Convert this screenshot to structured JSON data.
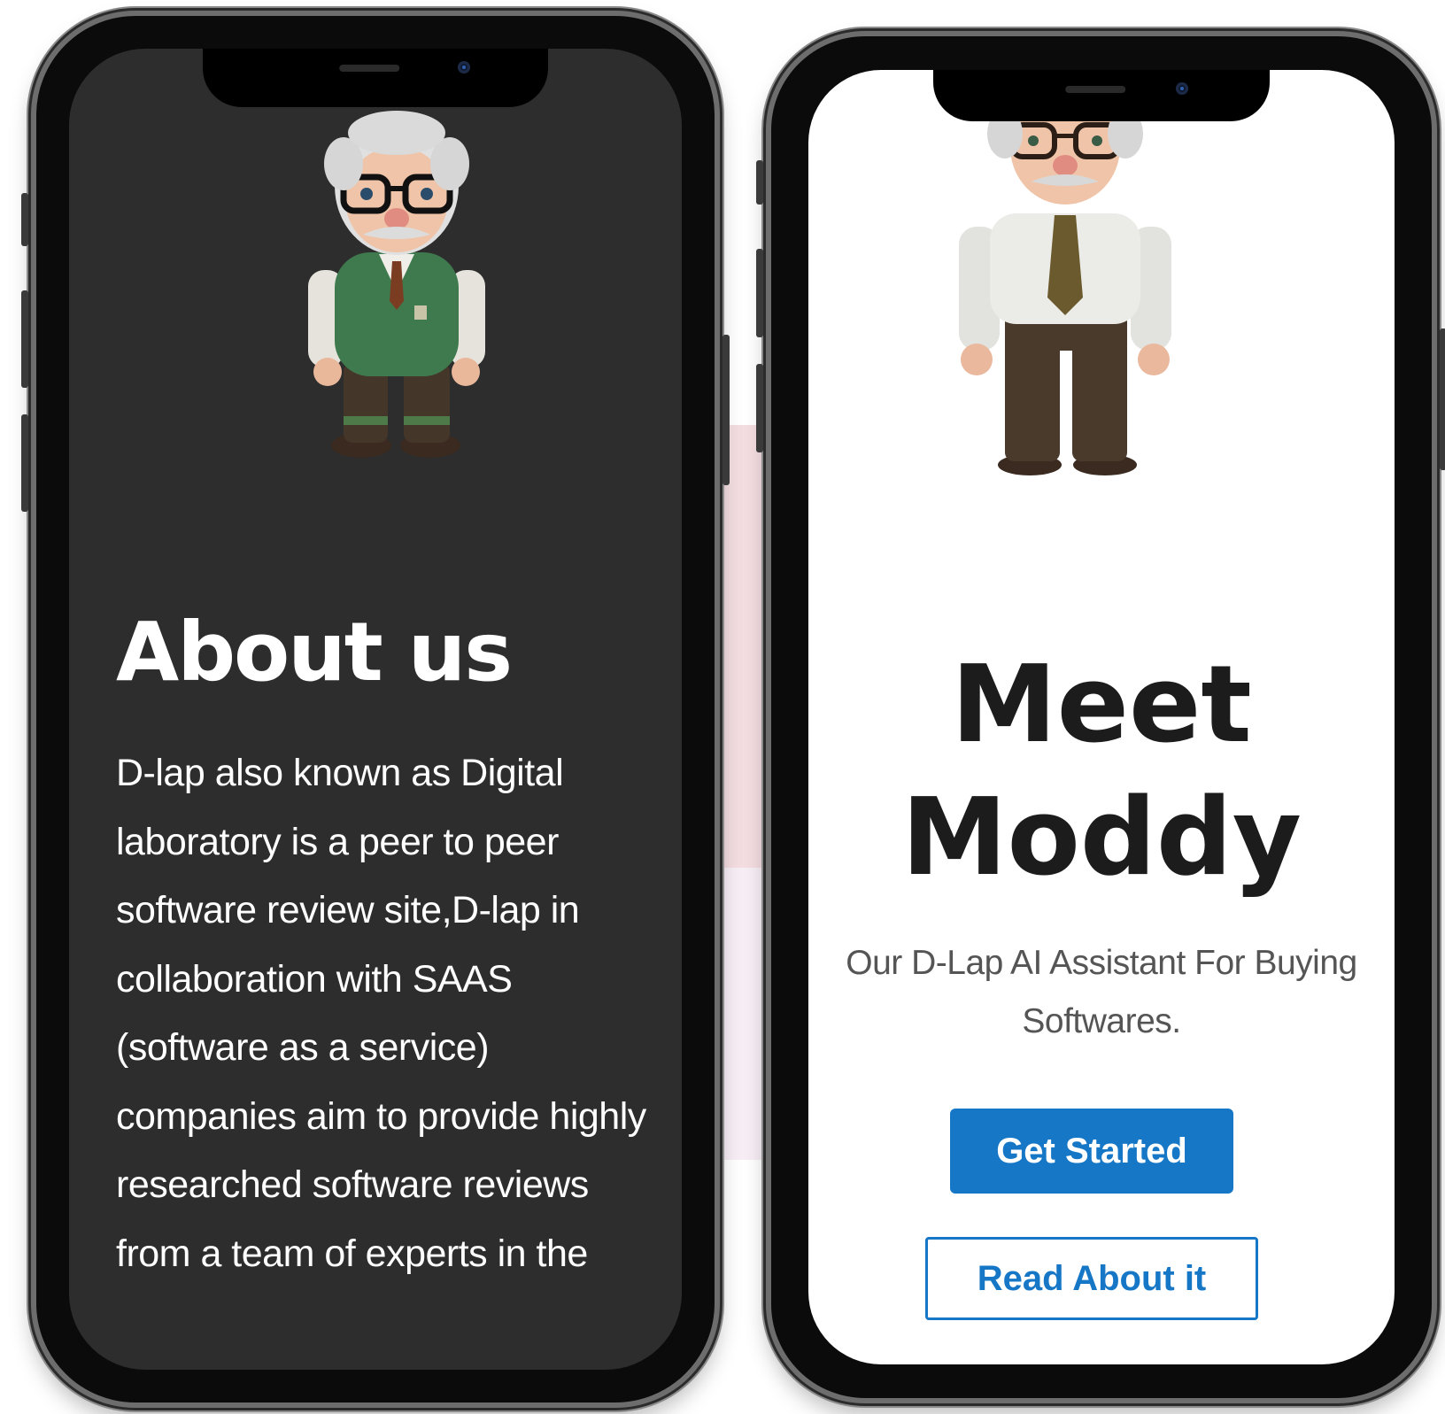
{
  "about_phone": {
    "character_name": "Moddy",
    "title": "About us",
    "body": "D-lap also known as Digital laboratory is a peer to peer software review site,D-lap in collaboration with SAAS (software as a service) companies aim to provide highly researched software reviews from a team of experts in the"
  },
  "moddy_phone": {
    "character_name": "Moddy",
    "title": "Meet Moddy",
    "subtitle": "Our D-Lap AI Assistant For Buying Softwares.",
    "get_started_label": "Get Started",
    "read_about_label": "Read About it"
  },
  "colors": {
    "dark_screen": "#2d2d2d",
    "primary_blue": "#1677c7",
    "vest_green": "#3f7a4e",
    "pants_brown": "#4a3a2c"
  }
}
